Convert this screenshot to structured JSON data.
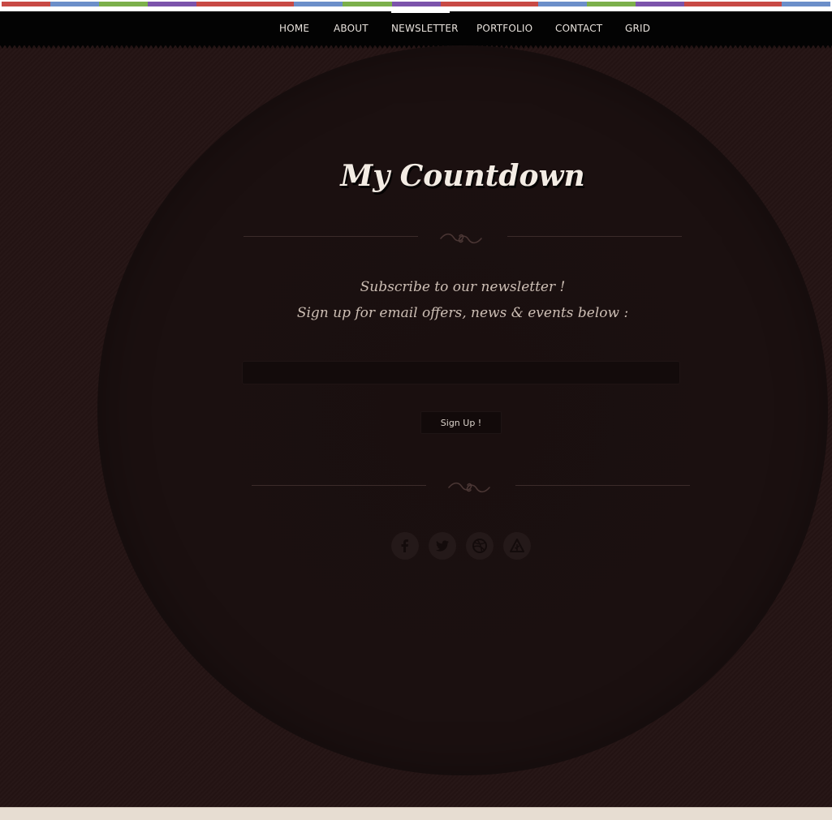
{
  "nav": {
    "items": [
      {
        "label": "HOME"
      },
      {
        "label": "ABOUT"
      },
      {
        "label": "NEWSLETTER",
        "active": true
      },
      {
        "label": "PORTFOLIO"
      },
      {
        "label": "CONTACT"
      },
      {
        "label": "GRID"
      }
    ]
  },
  "stripe_colors": [
    "#c84a45",
    "#6c8fc9",
    "#7cb04b",
    "#7c54ab",
    "#c84a45",
    "#c84a45",
    "#6c8fc9",
    "#7cb04b",
    "#7c54ab",
    "#c84a45",
    "#c84a45",
    "#6c8fc9",
    "#7cb04b",
    "#7c54ab",
    "#c84a45",
    "#c84a45",
    "#6c8fc9"
  ],
  "header": {
    "title": "My Countdown"
  },
  "newsletter": {
    "line1": "Subscribe to our newsletter !",
    "line2": "Sign up for email offers, news & events below :",
    "email_placeholder": "",
    "signup_label": "Sign Up !"
  },
  "social": [
    {
      "icon": "facebook-icon"
    },
    {
      "icon": "twitter-icon"
    },
    {
      "icon": "dribbble-icon"
    },
    {
      "icon": "forrst-icon"
    }
  ],
  "colors": {
    "background": "#241414",
    "navbar": "#030303",
    "circle": "#1b1010",
    "title": "#f3ece4",
    "subtitle": "#cdbfb5",
    "footer": "#e7ddd2"
  }
}
